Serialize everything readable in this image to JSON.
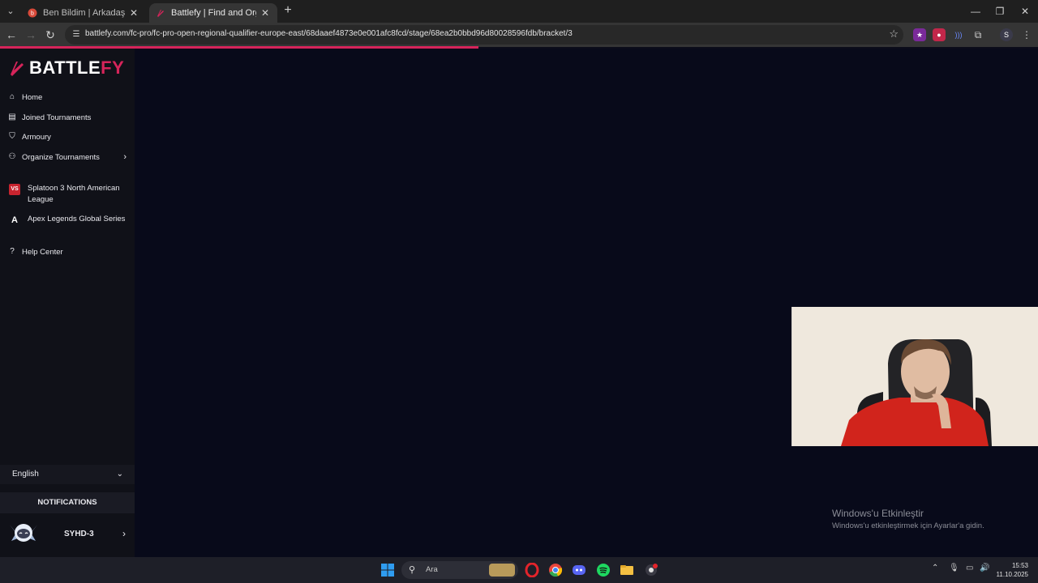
{
  "browser": {
    "tabs": [
      {
        "title": "Ben Bildim | Arkadaşlarınla Onli",
        "favicon": "benbildim-icon",
        "active": false
      },
      {
        "title": "Battlefy | Find and Organize Esp",
        "favicon": "battlefy-icon",
        "active": true
      }
    ],
    "address_url": "battlefy.com/fc-pro/fc-pro-open-regional-qualifier-europe-east/68daaef4873e0e001afc8fcd/stage/68ea2b0bbd96d80028596fdb/bracket/3"
  },
  "sidebar": {
    "logo": {
      "part1": "BATTLE",
      "part2": "FY"
    },
    "nav": [
      {
        "label": "Home",
        "icon": "home-icon"
      },
      {
        "label": "Joined Tournaments",
        "icon": "calendar-icon"
      },
      {
        "label": "Armoury",
        "icon": "shield-icon"
      },
      {
        "label": "Organize Tournaments",
        "icon": "organize-icon"
      }
    ],
    "games": [
      {
        "label": "Splatoon 3 North American League",
        "icon": "splatoon-icon",
        "badge": "VS"
      },
      {
        "label": "Apex Legends Global Series",
        "icon": "apex-icon",
        "badge": "A"
      }
    ],
    "help": {
      "label": "Help Center",
      "icon": "help-icon"
    },
    "language": "English",
    "notifications": "NOTIFICATIONS",
    "username": "SYHD-3"
  },
  "watermark": {
    "line1": "Windows'u Etkinleştir",
    "line2": "Windows'u etkinleştirmek için Ayarlar'a gidin."
  },
  "taskbar": {
    "search_placeholder": "Ara",
    "time": "15:53",
    "date": "11.10.2025"
  },
  "colors": {
    "brand": "#d6245a",
    "sidebar_bg": "#101118",
    "main_bg": "#080a1a"
  }
}
